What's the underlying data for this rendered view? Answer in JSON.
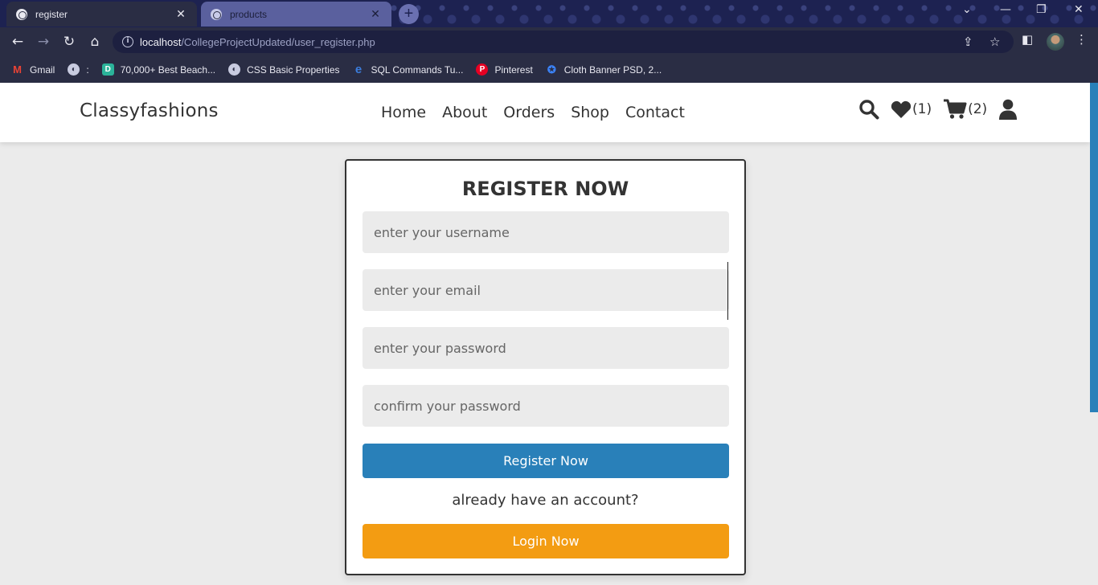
{
  "browser": {
    "tabs": [
      {
        "title": "register",
        "active": true
      },
      {
        "title": "products",
        "active": false
      }
    ],
    "address": {
      "host": "localhost",
      "path": "/CollegeProjectUpdated/user_register.php"
    },
    "bookmarks": [
      {
        "label": "Gmail",
        "icon": "gmail-icon"
      },
      {
        "label": ":",
        "icon": "globe-icon"
      },
      {
        "label": "70,000+ Best Beach...",
        "icon": "d-icon"
      },
      {
        "label": "CSS Basic Properties",
        "icon": "globe-icon"
      },
      {
        "label": "SQL Commands Tu...",
        "icon": "e-icon"
      },
      {
        "label": "Pinterest",
        "icon": "pinterest-icon"
      },
      {
        "label": "Cloth Banner PSD, 2...",
        "icon": "pikbest-icon"
      }
    ]
  },
  "site": {
    "logo": "Classyfashions",
    "nav": [
      "Home",
      "About",
      "Orders",
      "Shop",
      "Contact"
    ],
    "wishlist_count": "(1)",
    "cart_count": "(2)"
  },
  "form": {
    "title": "register now",
    "username_placeholder": "enter your username",
    "email_placeholder": "enter your email",
    "password_placeholder": "enter your password",
    "confirm_placeholder": "confirm your password",
    "register_label": "Register Now",
    "already_text": "already have an account?",
    "login_label": "Login Now"
  },
  "colors": {
    "primary": "#2980b9",
    "accent": "#f39c12",
    "chrome": "#1d2251",
    "page_bg": "#ebebeb"
  }
}
